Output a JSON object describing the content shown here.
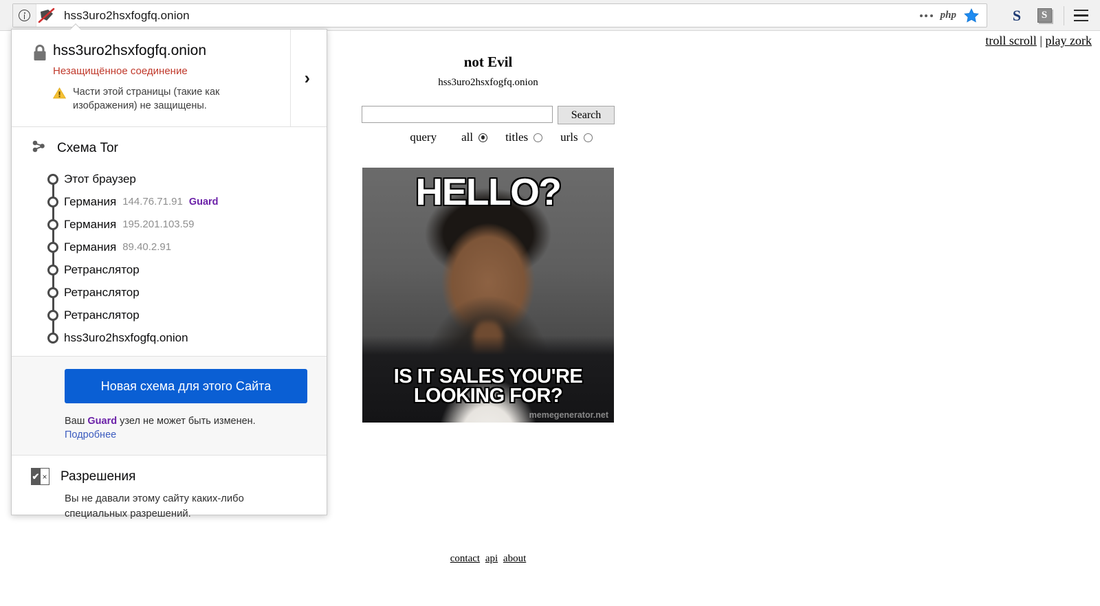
{
  "browser": {
    "url": "hss3uro2hsxfogfq.onion",
    "identity_icon": "info-circle-icon",
    "shield_icon": "shield-slash-icon",
    "urlbar_icons": [
      "more-dots-icon",
      "php-badge-icon",
      "bookmark-star-icon"
    ],
    "php_label": "php",
    "toolbar_extensions": [
      {
        "name": "extension-s-plain",
        "label": "S"
      },
      {
        "name": "extension-s-box",
        "label": "S"
      }
    ],
    "menu_icon": "hamburger-menu-icon"
  },
  "identity_panel": {
    "site": {
      "lock_icon": "padlock-icon",
      "host": "hss3uro2hsxfogfq.onion",
      "connection_status": "Незащищённое соединение",
      "warning_icon": "warning-triangle-icon",
      "warning_text": "Части этой страницы (такие как изображения) не защищены.",
      "expand_icon": "chevron-right-icon"
    },
    "circuit": {
      "icon": "tor-circuit-icon",
      "title": "Схема Tor",
      "nodes": [
        {
          "label": "Этот браузер",
          "ip": "",
          "badge": ""
        },
        {
          "label": "Германия",
          "ip": "144.76.71.91",
          "badge": "Guard"
        },
        {
          "label": "Германия",
          "ip": "195.201.103.59",
          "badge": ""
        },
        {
          "label": "Германия",
          "ip": "89.40.2.91",
          "badge": ""
        },
        {
          "label": "Ретранслятор",
          "ip": "",
          "badge": ""
        },
        {
          "label": "Ретранслятор",
          "ip": "",
          "badge": ""
        },
        {
          "label": "Ретранслятор",
          "ip": "",
          "badge": ""
        },
        {
          "label": "hss3uro2hsxfogfq.onion",
          "ip": "",
          "badge": ""
        }
      ]
    },
    "new_circuit": {
      "button_label": "Новая схема для этого Сайта",
      "button_color": "#0a5fd4",
      "note_prefix": "Ваш ",
      "note_guard": "Guard",
      "note_suffix": " узел не может быть изменен.",
      "learn_more": "Подробнее",
      "learn_more_color": "#3b5bbf"
    },
    "permissions": {
      "icon": "permissions-checkbox-icon",
      "icon_check": "✔",
      "icon_cross": "×",
      "title": "Разрешения",
      "text": "Вы не давали этому сайту каких-либо специальных разрешений."
    }
  },
  "page": {
    "top_links": {
      "troll_scroll": "troll scroll",
      "separator": " | ",
      "play_zork": "play zork"
    },
    "title": "not Evil",
    "subtitle": "hss3uro2hsxfogfq.onion",
    "search": {
      "value": "",
      "placeholder": "",
      "button_label": "Search"
    },
    "query_label": "query",
    "query_options": [
      {
        "label": "all",
        "checked": true
      },
      {
        "label": "titles",
        "checked": false
      },
      {
        "label": "urls",
        "checked": false
      }
    ],
    "meme": {
      "top_text": "HELLO?",
      "bottom_text": "IS IT SALES YOU'RE LOOKING FOR?",
      "watermark": "memegenerator.net"
    },
    "footer_links": [
      "contact",
      "api",
      "about"
    ]
  }
}
